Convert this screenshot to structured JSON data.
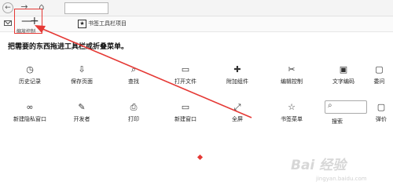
{
  "nav": {
    "back": "←",
    "forward": "→",
    "home": "⌂"
  },
  "bookmarks_row": {
    "zoom_minus": "—",
    "zoom_plus": "+",
    "zoom_label": "缩放控制",
    "bookmark_item_label": "书签工具栏项目"
  },
  "instruction": "把需要的东西拖进工具栏或折叠菜单。",
  "items": [
    {
      "label": "历史记录",
      "icon": "◷"
    },
    {
      "label": "保存页面",
      "icon": "⇩"
    },
    {
      "label": "查找",
      "icon": "⌕"
    },
    {
      "label": "打开文件",
      "icon": "▭"
    },
    {
      "label": "附加组件",
      "icon": "✚"
    },
    {
      "label": "编辑控制",
      "icon": "✂"
    },
    {
      "label": "文字编码",
      "icon": "▣"
    },
    {
      "label": "委问",
      "icon": "▢"
    },
    {
      "label": "新建隐私窗口",
      "icon": "∞"
    },
    {
      "label": "开发者",
      "icon": "✎"
    },
    {
      "label": "打印",
      "icon": "⎙"
    },
    {
      "label": "新建窗口",
      "icon": "▭"
    },
    {
      "label": "全屏",
      "icon": "⤢"
    },
    {
      "label": "书签菜单",
      "icon": "☆"
    },
    {
      "label": "搜索",
      "icon": "⌕"
    },
    {
      "label": "弹价",
      "icon": "▢"
    }
  ],
  "watermark": "Bai 经验",
  "watermark_sub": "jingyan.baidu.com",
  "colors": {
    "highlight": "#e53935",
    "toolbar": "#f4f4f4"
  }
}
